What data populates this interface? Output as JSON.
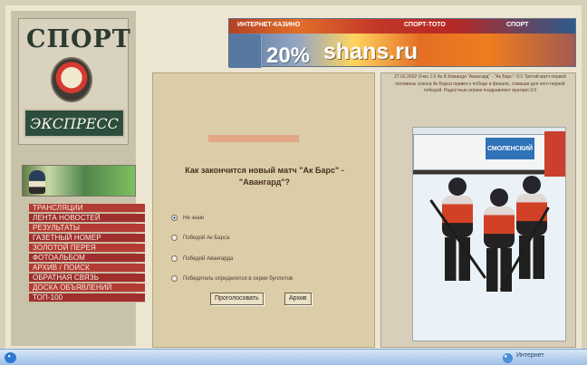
{
  "brand": {
    "top": "СПОРТ",
    "bottom": "ЭКСПРЕСС"
  },
  "sidebar": {
    "caption": "",
    "banner_text": "",
    "menu": [
      "ТРАНСЛЯЦИИ",
      "ЛЕНТА НОВОСТЕЙ",
      "РЕЗУЛЬТАТЫ",
      "ГАЗЕТНЫЙ НОМЕР",
      "ЗОЛОТОЙ ПЕРЕЯ",
      "ФОТОАЛЬБОМ",
      "АРХИВ / ПОИСК",
      "ОБРАТНАЯ СВЯЗЬ",
      "ДОСКА ОБЪЯВЛЕНИЙ",
      "ТОП-100"
    ]
  },
  "header_ad": {
    "top_links": [
      "ИНТЕРНЕТ-КАЗИНО",
      "СПОРТ-ТОТО",
      "СПОРТ"
    ],
    "discount": "20%",
    "site": "shans.ru"
  },
  "poll": {
    "question": "Как закончится новый матч \"Ак Барс\" - \"Авангард\"?",
    "options": [
      {
        "label": "Не знаю",
        "selected": true
      },
      {
        "label": "Победой Ак Барса",
        "selected": false
      },
      {
        "label": "Победой Авангарда",
        "selected": false
      },
      {
        "label": "Победитель определится в серии буллитов",
        "selected": false
      }
    ],
    "vote_button": "Проголосовать",
    "archive_button": "Архив"
  },
  "news": {
    "text": "27.02.2002 Очко 1:0 Ак Б Команда \"Авангард\" - \"Ак Барс\": 0:3 Третий матч первой половины сезона Ак Барса привел к победе в финале, ставшая для него первой победой. Радостные игроки поздравляют вратаря 3:0"
  },
  "photo": {
    "ad_text": "СМОЛЕНСКИЙ"
  },
  "taskbar": {
    "internet_label": "Интернет"
  },
  "colors": {
    "menu_red": "#b33b33",
    "poll_bg": "#dbcda7",
    "news_bg": "#d8cfba"
  }
}
